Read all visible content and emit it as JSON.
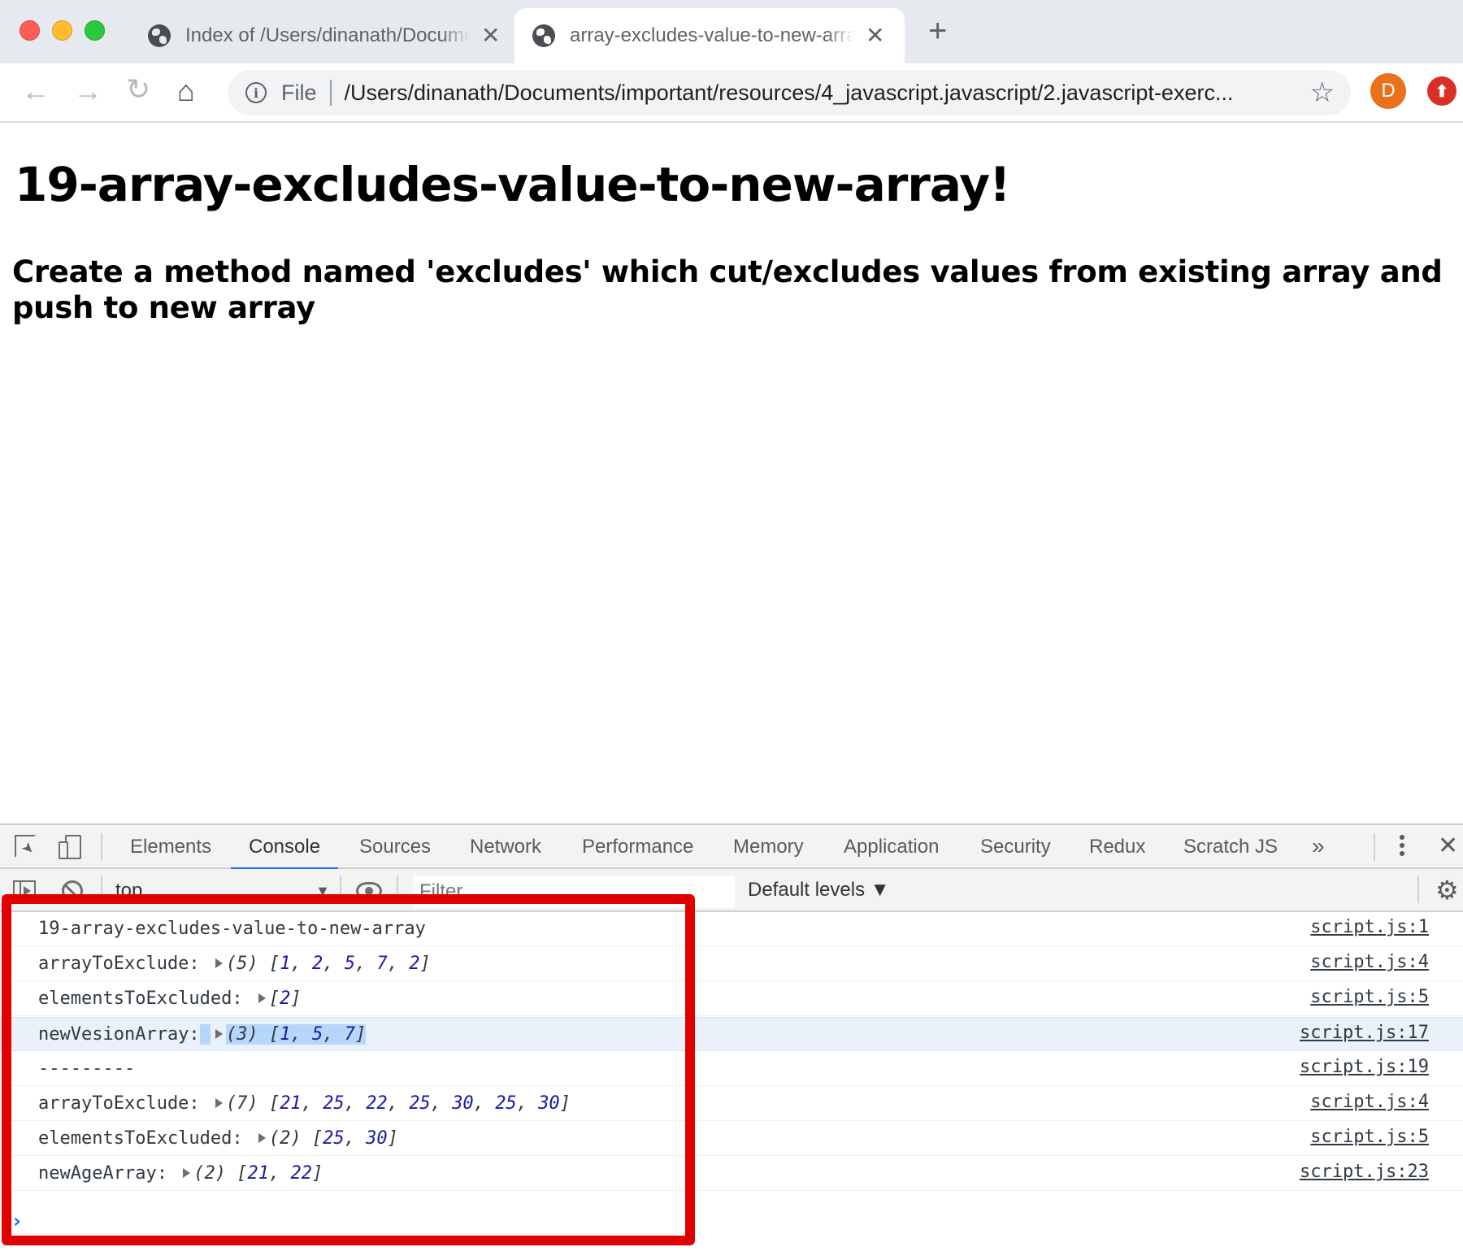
{
  "browser": {
    "window_controls": [
      "close",
      "minimize",
      "maximize"
    ],
    "tabs": [
      {
        "title": "Index of /Users/dinanath/Documents/important/resources",
        "icon": "globe-icon",
        "active": false
      },
      {
        "title": "array-excludes-value-to-new-array",
        "icon": "globe-icon",
        "active": true
      }
    ],
    "new_tab_label": "+",
    "close_glyph": "✕",
    "nav": {
      "back": "←",
      "forward": "→",
      "reload": "↻",
      "home": "⌂"
    },
    "omnibox": {
      "info_glyph": "i",
      "scheme": "File",
      "url": "/Users/dinanath/Documents/important/resources/4_javascript.javascript/2.javascript-exerc...",
      "star_glyph": "☆"
    },
    "profile_initial": "D",
    "extension_glyph": "⬆",
    "colors": {
      "profile": "#e8711a",
      "extension": "#d93025"
    }
  },
  "page": {
    "heading": "19-array-excludes-value-to-new-array!",
    "subheading": "Create a method named 'excludes' which cut/excludes values from existing array and push to new array"
  },
  "devtools": {
    "tabs": [
      "Elements",
      "Console",
      "Sources",
      "Network",
      "Performance",
      "Memory",
      "Application",
      "Security",
      "Redux",
      "Scratch JS"
    ],
    "active_tab": "Console",
    "more_tabs_glyph": "»",
    "close_glyph": "✕",
    "gear_glyph": "⚙",
    "console_toolbar": {
      "context": "top",
      "context_arrow": "▼",
      "filter_placeholder": "Filter",
      "levels": "Default levels ▼"
    },
    "accent_color": "#1a73e8",
    "console_rows": [
      {
        "label": "19-array-excludes-value-to-new-array",
        "count": "",
        "values": [],
        "source": "script.js:1"
      },
      {
        "label": "arrayToExclude:",
        "count": "(5)",
        "values": [
          "1",
          "2",
          "5",
          "7",
          "2"
        ],
        "source": "script.js:4"
      },
      {
        "label": "elementsToExcluded:",
        "count": "",
        "values": [
          "2"
        ],
        "source": "script.js:5"
      },
      {
        "label": "newVesionArray:",
        "count": "(3)",
        "values": [
          "1",
          "5",
          "7"
        ],
        "source": "script.js:17",
        "selected": true
      },
      {
        "label": "---------",
        "count": "",
        "values": [],
        "source": "script.js:19"
      },
      {
        "label": "arrayToExclude:",
        "count": "(7)",
        "values": [
          "21",
          "25",
          "22",
          "25",
          "30",
          "25",
          "30"
        ],
        "source": "script.js:4"
      },
      {
        "label": "elementsToExcluded:",
        "count": "(2)",
        "values": [
          "25",
          "30"
        ],
        "source": "script.js:5"
      },
      {
        "label": "newAgeArray:",
        "count": "(2)",
        "values": [
          "21",
          "22"
        ],
        "source": "script.js:23"
      }
    ],
    "prompt_glyph": "›"
  },
  "annotation": {
    "color": "#e00000",
    "description": "red highlight box around console output"
  }
}
